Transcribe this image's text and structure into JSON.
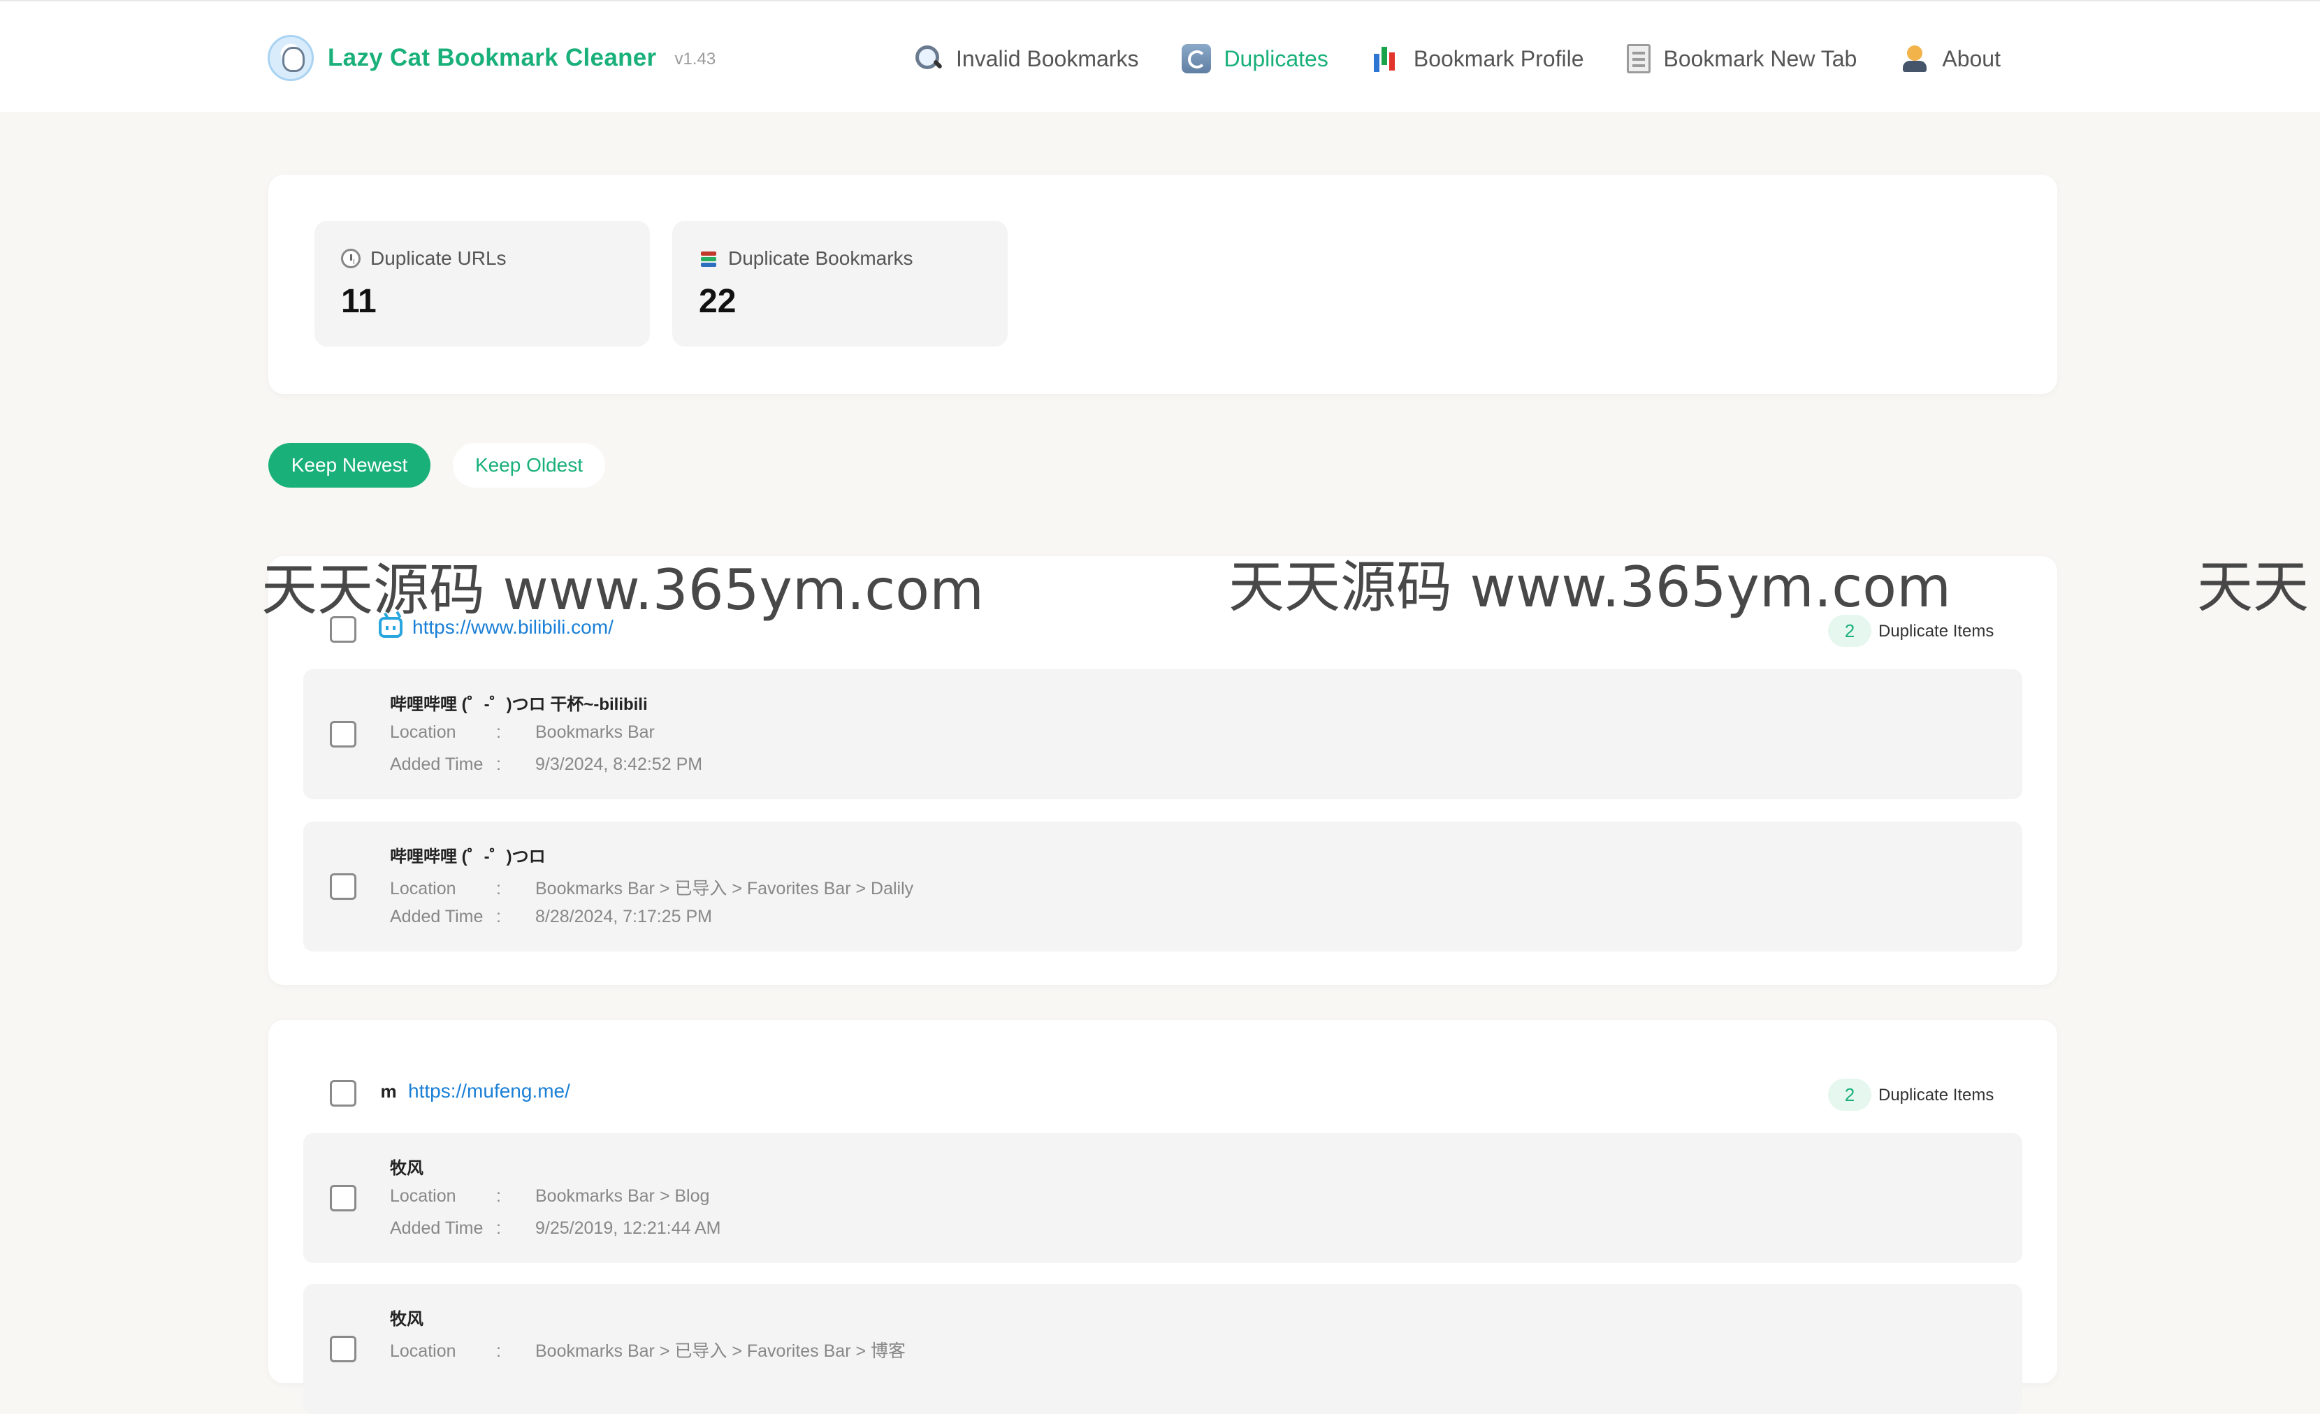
{
  "header": {
    "app_title": "Lazy Cat Bookmark Cleaner",
    "version": "v1.43",
    "nav": [
      {
        "label": "Invalid Bookmarks",
        "icon": "magnifier-icon",
        "active": false
      },
      {
        "label": "Duplicates",
        "icon": "refresh-icon",
        "active": true
      },
      {
        "label": "Bookmark Profile",
        "icon": "bar-chart-icon",
        "active": false
      },
      {
        "label": "Bookmark New Tab",
        "icon": "document-icon",
        "active": false
      },
      {
        "label": "About",
        "icon": "person-icon",
        "active": false
      }
    ]
  },
  "stats": {
    "duplicate_urls": {
      "label": "Duplicate URLs",
      "value": "11",
      "icon": "clock-icon"
    },
    "duplicate_bookmarks": {
      "label": "Duplicate Bookmarks",
      "value": "22",
      "icon": "books-icon"
    }
  },
  "actions": {
    "keep_newest": "Keep Newest",
    "keep_oldest": "Keep Oldest"
  },
  "labels": {
    "duplicate_items": "Duplicate Items",
    "location": "Location",
    "added_time": "Added Time",
    "colon": ":"
  },
  "groups": [
    {
      "url": "https://www.bilibili.com/",
      "favicon": "bilibili-icon",
      "count": "2",
      "items": [
        {
          "title": "哔哩哔哩 (゜-゜)つロ 干杯~-bilibili",
          "location": "Bookmarks Bar",
          "added": "9/3/2024, 8:42:52 PM"
        },
        {
          "title": "哔哩哔哩 (゜-゜)つロ",
          "location": "Bookmarks Bar > 已导入 > Favorites Bar > Dalily",
          "added": "8/28/2024, 7:17:25 PM"
        }
      ]
    },
    {
      "url": "https://mufeng.me/",
      "favicon": "m-icon",
      "count": "2",
      "items": [
        {
          "title": "牧风",
          "location": "Bookmarks Bar > Blog",
          "added": "9/25/2019, 12:21:44 AM"
        },
        {
          "title": "牧风",
          "location": "Bookmarks Bar > 已导入 > Favorites Bar > 博客",
          "added": ""
        }
      ]
    }
  ],
  "watermark": "天天源码 www.365ym.com",
  "watermark_partial": "天天"
}
